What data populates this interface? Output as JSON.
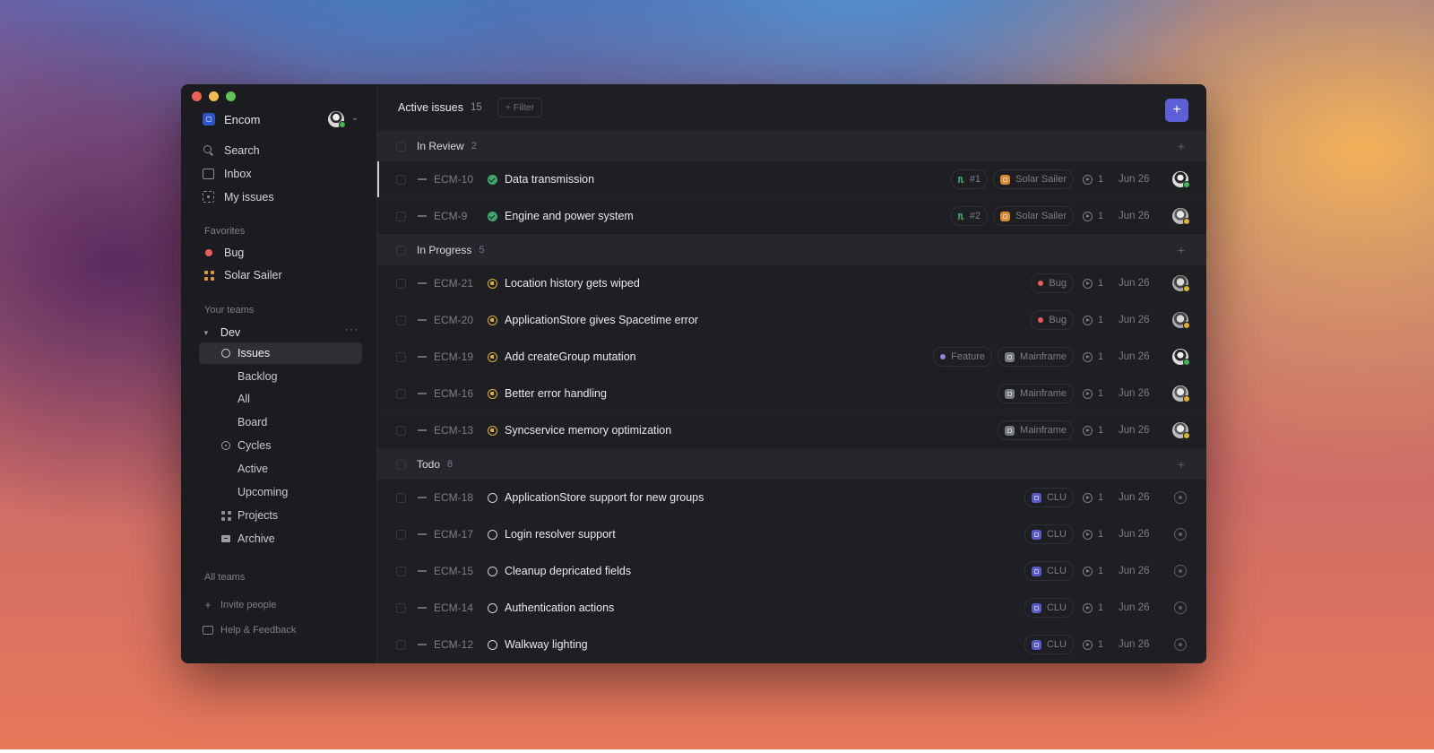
{
  "workspace": {
    "name": "Encom"
  },
  "sidebar": {
    "nav": [
      {
        "label": "Search",
        "icon": "search-icon"
      },
      {
        "label": "Inbox",
        "icon": "inbox-icon"
      },
      {
        "label": "My issues",
        "icon": "my-issues-icon"
      }
    ],
    "favorites_label": "Favorites",
    "favorites": [
      {
        "label": "Bug",
        "icon": "label-dot-icon",
        "color": "#eb5b5b"
      },
      {
        "label": "Solar Sailer",
        "icon": "project-grid-icon",
        "color": "#e39a2d"
      }
    ],
    "teams_label": "Your teams",
    "team": {
      "name": "Dev",
      "items": [
        {
          "label": "Issues",
          "icon": "issues-circle-icon",
          "active": true
        },
        {
          "label": "Backlog"
        },
        {
          "label": "All"
        },
        {
          "label": "Board"
        },
        {
          "label": "Cycles",
          "icon": "cycles-icon"
        },
        {
          "label": "Active"
        },
        {
          "label": "Upcoming"
        },
        {
          "label": "Projects",
          "icon": "projects-grid-icon"
        },
        {
          "label": "Archive",
          "icon": "archive-icon"
        }
      ]
    },
    "all_teams_label": "All teams",
    "invite_label": "Invite people",
    "help_label": "Help & Feedback"
  },
  "header": {
    "title": "Active issues",
    "count": "15",
    "filter_label": "+ Filter",
    "new_issue_icon": "plus-icon"
  },
  "groups": [
    {
      "label": "In Review",
      "count": "2",
      "status": "review",
      "issues": [
        {
          "id": "ECM-10",
          "title": "Data transmission",
          "pr": "#1",
          "project": "Solar Sailer",
          "project_color": "#d9892f",
          "estimate": "1",
          "date": "Jun 26",
          "assignee": "a",
          "assignee_status": "green"
        },
        {
          "id": "ECM-9",
          "title": "Engine and power system",
          "pr": "#2",
          "project": "Solar Sailer",
          "project_color": "#d9892f",
          "estimate": "1",
          "date": "Jun 26",
          "assignee": "b",
          "assignee_status": "yellow"
        }
      ]
    },
    {
      "label": "In Progress",
      "count": "5",
      "status": "progress",
      "issues": [
        {
          "id": "ECM-21",
          "title": "Location history gets wiped",
          "label": "Bug",
          "label_color": "#eb5b5b",
          "estimate": "1",
          "date": "Jun 26",
          "assignee": "c",
          "assignee_status": "yellow"
        },
        {
          "id": "ECM-20",
          "title": "ApplicationStore gives Spacetime error",
          "label": "Bug",
          "label_color": "#eb5b5b",
          "estimate": "1",
          "date": "Jun 26",
          "assignee": "c",
          "assignee_status": "yellow"
        },
        {
          "id": "ECM-19",
          "title": "Add createGroup mutation",
          "label": "Feature",
          "label_color": "#9b7be6",
          "project": "Mainframe",
          "project_color": "#7a7c83",
          "estimate": "1",
          "date": "Jun 26",
          "assignee": "a",
          "assignee_status": "green"
        },
        {
          "id": "ECM-16",
          "title": "Better error handling",
          "project": "Mainframe",
          "project_color": "#7a7c83",
          "estimate": "1",
          "date": "Jun 26",
          "assignee": "b",
          "assignee_status": "yellow"
        },
        {
          "id": "ECM-13",
          "title": "Syncservice memory optimization",
          "project": "Mainframe",
          "project_color": "#7a7c83",
          "estimate": "1",
          "date": "Jun 26",
          "assignee": "b",
          "assignee_status": "yellow"
        }
      ]
    },
    {
      "label": "Todo",
      "count": "8",
      "status": "todo",
      "issues": [
        {
          "id": "ECM-18",
          "title": "ApplicationStore support for new groups",
          "project": "CLU",
          "project_color": "#5a5acb",
          "estimate": "1",
          "date": "Jun 26",
          "assignee": "none"
        },
        {
          "id": "ECM-17",
          "title": "Login resolver support",
          "project": "CLU",
          "project_color": "#5a5acb",
          "estimate": "1",
          "date": "Jun 26",
          "assignee": "none"
        },
        {
          "id": "ECM-15",
          "title": "Cleanup depricated fields",
          "project": "CLU",
          "project_color": "#5a5acb",
          "estimate": "1",
          "date": "Jun 26",
          "assignee": "none"
        },
        {
          "id": "ECM-14",
          "title": "Authentication actions",
          "project": "CLU",
          "project_color": "#5a5acb",
          "estimate": "1",
          "date": "Jun 26",
          "assignee": "none"
        },
        {
          "id": "ECM-12",
          "title": "Walkway lighting",
          "project": "CLU",
          "project_color": "#5a5acb",
          "estimate": "1",
          "date": "Jun 26",
          "assignee": "none"
        }
      ]
    }
  ],
  "colors": {
    "accent": "#5e5ed6",
    "in_review": "#3fa66d",
    "in_progress": "#e0b12e"
  }
}
